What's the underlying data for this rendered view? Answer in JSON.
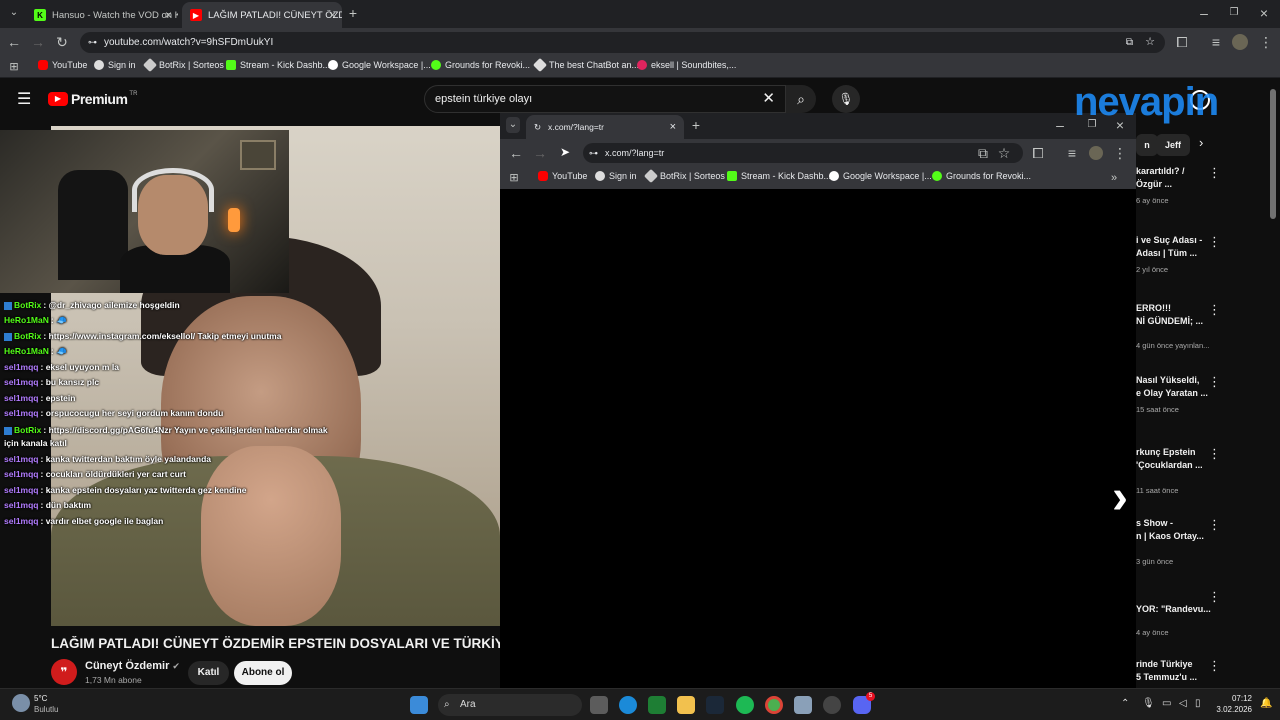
{
  "browser": {
    "tabs": [
      {
        "label": "Hansuo - Watch the VOD on Ki",
        "icon": "kick-icon"
      },
      {
        "label": "LAĞIM PATLADI! CÜNEYT ÖZD",
        "icon": "youtube-icon"
      }
    ],
    "url": "youtube.com/watch?v=9hSFDmUukYI",
    "bookmarks": [
      "YouTube",
      "Sign in",
      "BotRix | Sorteos",
      "Stream - Kick Dashb...",
      "Google Workspace |...",
      "Grounds for Revoki...",
      "The best ChatBot an...",
      "eksell | Soundbites,..."
    ]
  },
  "youtube": {
    "logo": "Premium",
    "logo_sup": "TR",
    "search_value": "epstein türkiye olayı",
    "video_title": "LAĞIM PATLADI! CÜNEYT ÖZDEMİR EPSTEIN DOSYALARI VE TÜRKİYE İLİŞ",
    "channel": {
      "name": "Cüneyt Özdemir",
      "subs": "1,73 Mn abone",
      "join": "Katıl",
      "subscribe": "Abone ol"
    },
    "chips": [
      "n",
      "Jeff"
    ],
    "recommendations": [
      {
        "title1": "karartıldı? /",
        "title2": "Özgür ...",
        "meta": "6 ay önce"
      },
      {
        "title1": "i ve Suç Adası -",
        "title2": "Adası | Tüm ...",
        "meta": "2 yıl önce"
      },
      {
        "title1": "ERRO!!!",
        "title2": "Nİ GÜNDEMİ; ...",
        "meta": "4 gün önce yayınlan..."
      },
      {
        "title1": "Nasıl Yükseldi,",
        "title2": "e Olay Yaratan ...",
        "meta": "15 saat önce"
      },
      {
        "title1": "rkunç Epstein",
        "title2": "'Çocuklardan ...",
        "meta": "11 saat önce"
      },
      {
        "title1": "s Show -",
        "title2": "n | Kaos Ortay...",
        "meta": "3 gün önce"
      },
      {
        "title1": "YOR: \"Randevu...",
        "title2": "",
        "meta": "4 ay önce"
      },
      {
        "title1": "rinde Türkiye",
        "title2": "5 Temmuz'u ...",
        "meta": ""
      }
    ]
  },
  "chat": [
    {
      "user": "BotRix",
      "msg": ": @dr_zhivago ailemize hoşgeldin",
      "type": "bot"
    },
    {
      "user": "HeRo1MaN",
      "msg": ": 🧢",
      "type": "hero"
    },
    {
      "user": "BotRix",
      "msg": ": https://www.instagram.com/eksellol/ Takip etmeyi unutma",
      "type": "bot"
    },
    {
      "user": "HeRo1MaN",
      "msg": ": 🧢",
      "type": "hero"
    },
    {
      "user": "sel1mqq",
      "msg": ": eksel uyuyon m la",
      "type": "sel"
    },
    {
      "user": "sel1mqq",
      "msg": ": bu kansız plc",
      "type": "sel"
    },
    {
      "user": "sel1mqq",
      "msg": ": epstein",
      "type": "sel"
    },
    {
      "user": "sel1mqq",
      "msg": ": orspucocugu her seyi gordum kanım dondu",
      "type": "sel"
    },
    {
      "user": "BotRix",
      "msg": ": https://discord.gg/pAG6fu4Nzr Yayın ve çekilişlerden haberdar olmak",
      "type": "bot"
    },
    {
      "user": "",
      "msg": "için kanala katıl",
      "type": "cont"
    },
    {
      "user": "sel1mqq",
      "msg": ": kanka twitterdan baktım öyle yalandanda",
      "type": "sel"
    },
    {
      "user": "sel1mqq",
      "msg": ": cocukları öldürdükleri yer cart curt",
      "type": "sel"
    },
    {
      "user": "sel1mqq",
      "msg": ": kanka epstein dosyaları yaz twitterda gez kendine",
      "type": "sel"
    },
    {
      "user": "sel1mqq",
      "msg": ": dün baktım",
      "type": "sel"
    },
    {
      "user": "sel1mqq",
      "msg": ": vardır elbet google ile baglan",
      "type": "sel"
    }
  ],
  "popup": {
    "tab_label": "x.com/?lang=tr",
    "url": "x.com/?lang=tr",
    "bookmarks": [
      "YouTube",
      "Sign in",
      "BotRix | Sorteos",
      "Stream - Kick Dashb...",
      "Google Workspace |...",
      "Grounds for Revoki..."
    ]
  },
  "overlay_logo": "nevapin",
  "taskbar": {
    "weather_temp": "5°C",
    "weather_desc": "Bulutlu",
    "search_label": "Ara",
    "time": "07:12",
    "date": "3.02.2026",
    "discord_badge": "5"
  },
  "colors": {
    "youtube_red": "#ff0000",
    "kick_green": "#53fc18",
    "chat_purple": "#b27cff"
  }
}
